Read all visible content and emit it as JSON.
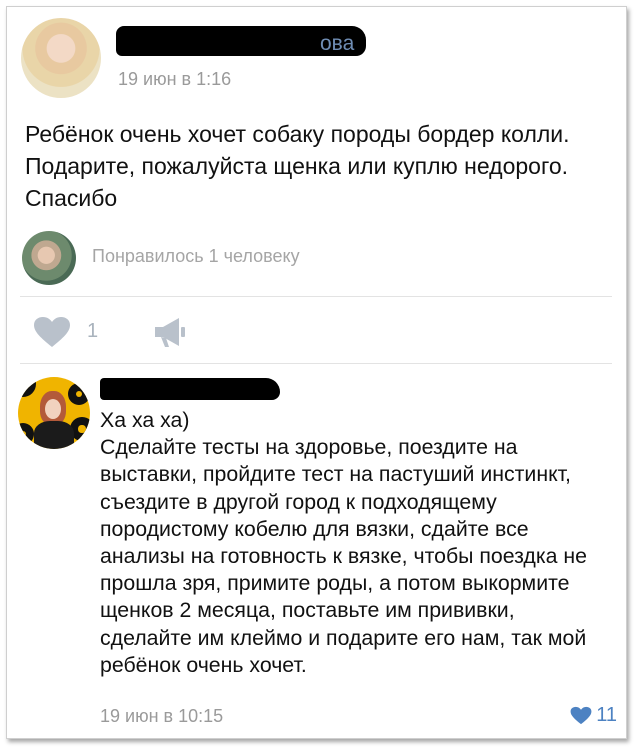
{
  "post": {
    "author_tail": "ова",
    "time": "19 июн в 1:16",
    "text": "Ребёнок очень хочет собаку породы бордер колли. Подарите, пожалуйста щенка или куплю недорого. Спасибо",
    "liked_by": "Понравилось 1 человеку",
    "like_count": "1"
  },
  "comment": {
    "greeting": "Ха ха ха)",
    "text": "Сделайте тесты на здоровье, поездите на выставки, пройдите тест на пастуший инстинкт, съездите в другой город к подходящему породистому кобелю для вязки, сдайте все анализы на готовность к вязке, чтобы поездка не прошла зря, примите роды, а потом выкормите щенков 2 месяца, поставьте им прививки, сделайте им клеймо и подарите его нам, так мой ребёнок очень хочет.",
    "time": "19 июн в 10:15",
    "like_count": "11"
  },
  "icons": {
    "heart": "heart-icon",
    "share": "megaphone-icon",
    "liked_heart": "heart-icon"
  },
  "colors": {
    "link": "#6f8db4",
    "liked_blue": "#4d82c2",
    "muted": "#9a9a9a",
    "icon_gray": "#b9c1cb"
  }
}
